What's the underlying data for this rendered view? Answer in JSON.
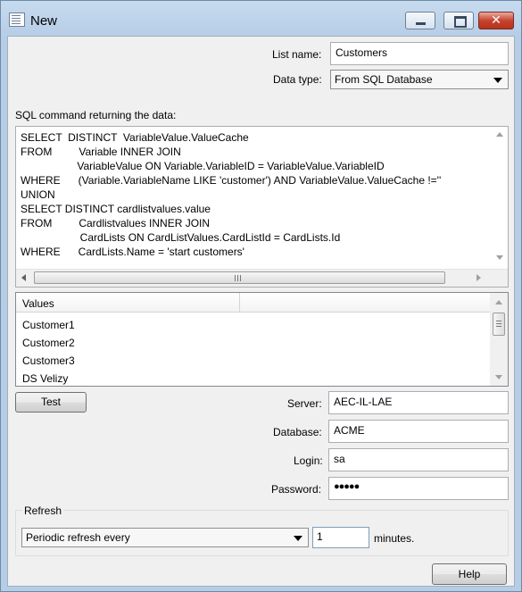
{
  "window": {
    "title": "New",
    "minimize_glyph": "minimize-icon",
    "maximize_glyph": "maximize-icon",
    "close_label": "✕"
  },
  "form": {
    "list_name_label": "List name:",
    "list_name_value": "Customers",
    "data_type_label": "Data type:",
    "data_type_value": "From SQL Database",
    "sql_label": "SQL command returning the data:",
    "sql_text": "SELECT  DISTINCT  VariableValue.ValueCache\nFROM         Variable INNER JOIN\n                   VariableValue ON Variable.VariableID = VariableValue.VariableID\nWHERE      (Variable.VariableName LIKE 'customer') AND VariableValue.ValueCache !=''\nUNION\nSELECT DISTINCT cardlistvalues.value\nFROM         Cardlistvalues INNER JOIN\n                    CardLists ON CardListValues.CardListId = CardLists.Id\nWHERE      CardLists.Name = 'start customers'"
  },
  "values": {
    "column_header": "Values",
    "items": [
      "Customer1",
      "Customer2",
      "Customer3",
      "DS Velizy"
    ]
  },
  "connection": {
    "test_label": "Test",
    "server_label": "Server:",
    "server_value": "AEC-IL-LAE",
    "database_label": "Database:",
    "database_value": "ACME",
    "login_label": "Login:",
    "login_value": "sa",
    "password_label": "Password:",
    "password_value": "●●●●●"
  },
  "refresh": {
    "group_label": "Refresh",
    "mode_value": "Periodic refresh every",
    "interval_value": "1",
    "unit_label": "minutes."
  },
  "footer": {
    "help_label": "Help"
  },
  "colors": {
    "title_bar": "#b6cde6",
    "close_button": "#c7432f",
    "dialog_background": "#f0f0f0"
  }
}
